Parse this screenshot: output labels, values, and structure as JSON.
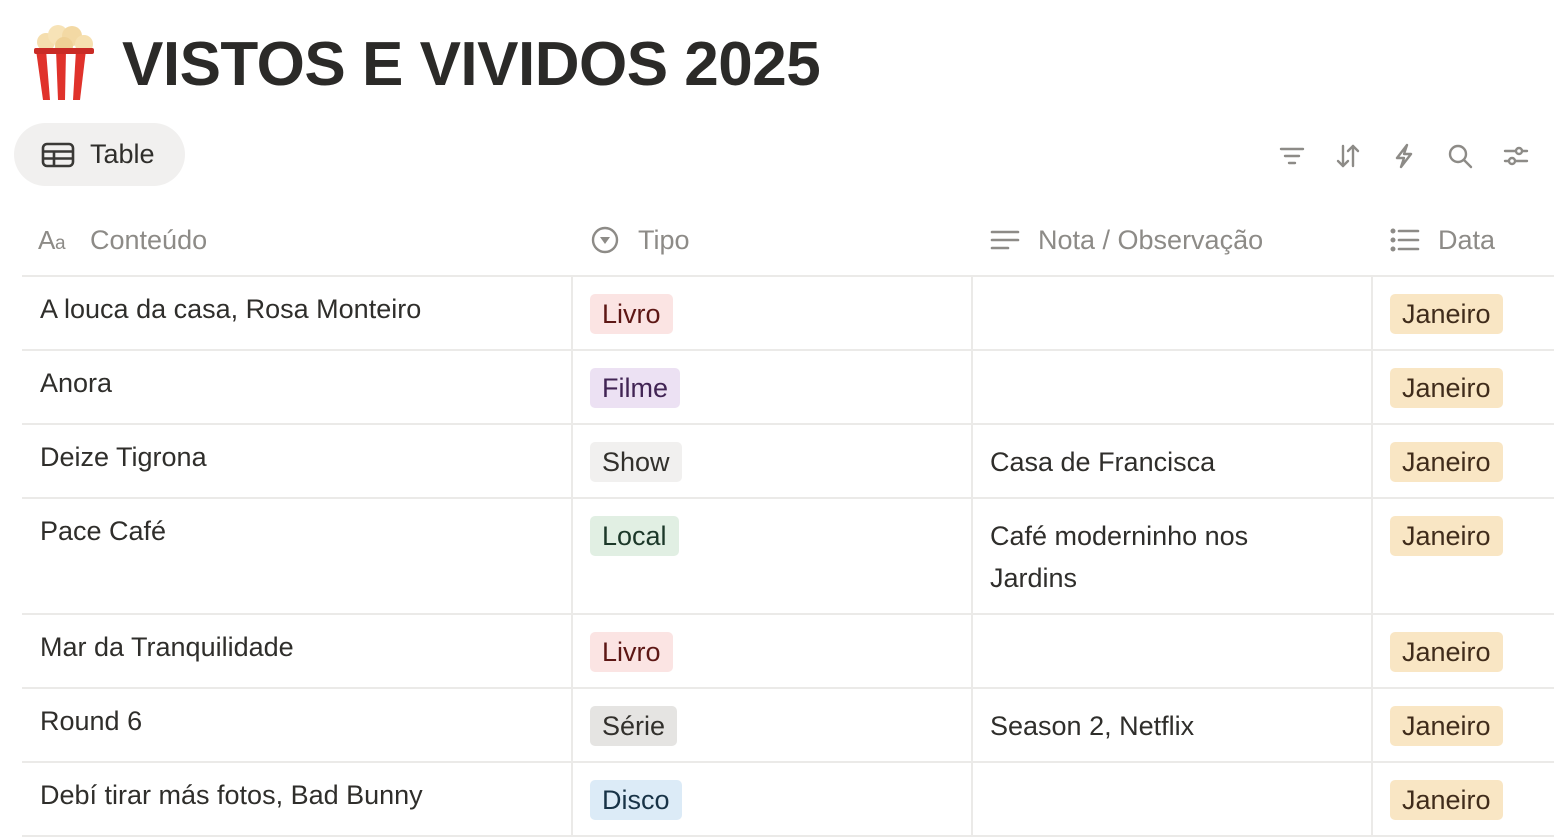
{
  "page": {
    "title": "VISTOS E VIVIDOS 2025",
    "icon": "popcorn-icon"
  },
  "view_tab": {
    "label": "Table",
    "icon": "table-icon"
  },
  "toolbar": [
    "filter-icon",
    "sort-icon",
    "lightning-icon",
    "search-icon",
    "settings-sliders-icon"
  ],
  "columns": [
    {
      "label": "Conteúdo",
      "icon": "text-aa-icon"
    },
    {
      "label": "Tipo",
      "icon": "select-icon"
    },
    {
      "label": "Nota / Observação",
      "icon": "text-lines-icon"
    },
    {
      "label": "Data",
      "icon": "list-icon"
    }
  ],
  "colors": {
    "livro": {
      "bg": "#fbe4e3",
      "fg": "#5d1715"
    },
    "filme": {
      "bg": "#ece1f3",
      "fg": "#412454"
    },
    "show": {
      "bg": "#f1f0ef",
      "fg": "#32302c"
    },
    "local": {
      "bg": "#e1efe3",
      "fg": "#1c3829"
    },
    "serie": {
      "bg": "#e5e4e2",
      "fg": "#32302c"
    },
    "disco": {
      "bg": "#dcebf7",
      "fg": "#183347"
    },
    "janeiro": {
      "bg": "#f9e6c4",
      "fg": "#402c1b"
    }
  },
  "rows": [
    {
      "conteudo": "A louca da casa, Rosa Monteiro",
      "tipo": "Livro",
      "nota": "",
      "data": "Janeiro"
    },
    {
      "conteudo": "Anora",
      "tipo": "Filme",
      "nota": "",
      "data": "Janeiro"
    },
    {
      "conteudo": "Deize Tigrona",
      "tipo": "Show",
      "nota": "Casa de Francisca",
      "data": "Janeiro"
    },
    {
      "conteudo": "Pace Café",
      "tipo": "Local",
      "nota": "Café moderninho nos Jardins",
      "data": "Janeiro"
    },
    {
      "conteudo": "Mar da Tranquilidade",
      "tipo": "Livro",
      "nota": "",
      "data": "Janeiro"
    },
    {
      "conteudo": "Round 6",
      "tipo": "Série",
      "nota": "Season 2, Netflix",
      "data": "Janeiro"
    },
    {
      "conteudo": "Debí tirar más fotos, Bad Bunny",
      "tipo": "Disco",
      "nota": "",
      "data": "Janeiro"
    }
  ]
}
